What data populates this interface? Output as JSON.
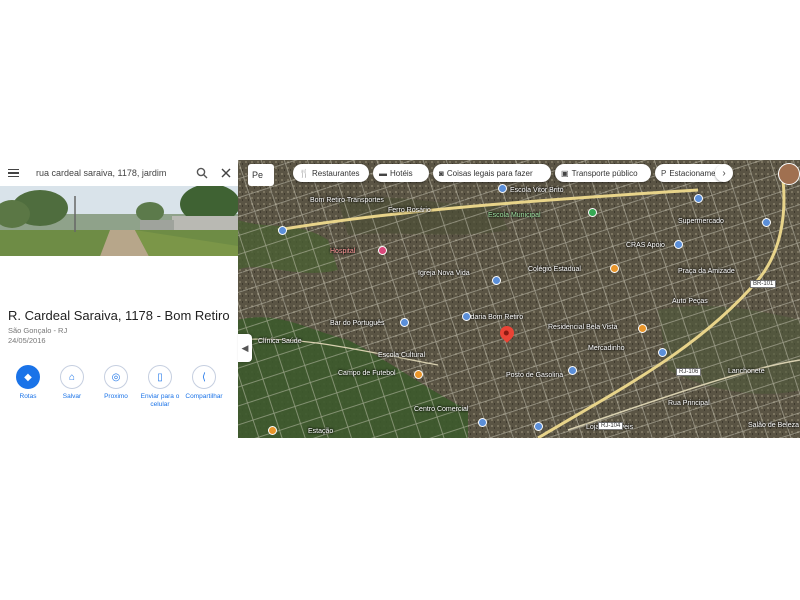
{
  "search": {
    "query": "rua cardeal saraiva, 1178, jardim"
  },
  "place": {
    "title": "R. Cardeal Saraiva, 1178 - Bom Retiro",
    "city": "São Gonçalo - RJ",
    "date": "24/05/2016"
  },
  "actions": [
    {
      "label": "Rotas",
      "icon": "◆"
    },
    {
      "label": "Salvar",
      "icon": "⌂"
    },
    {
      "label": "Proximo",
      "icon": "◎"
    },
    {
      "label": "Enviar para o\ncelular",
      "icon": "▯"
    },
    {
      "label": "Compartilhar",
      "icon": "⟨"
    }
  ],
  "panel_footer": "",
  "map": {
    "layer_label": "Pe",
    "chips": [
      {
        "label": "Restaurantes",
        "icon": "🍴"
      },
      {
        "label": "Hotéis",
        "icon": "▬"
      },
      {
        "label": "Coisas legais para fazer",
        "icon": "◙"
      },
      {
        "label": "Transporte público",
        "icon": "▣"
      },
      {
        "label": "Estacionamento",
        "icon": "P"
      }
    ],
    "labels": [
      {
        "text": "Escola Vitor Brito",
        "tone": "white"
      },
      {
        "text": "Bom Retiro Transportes",
        "tone": "white"
      },
      {
        "text": "Ferro Rosário",
        "tone": "white"
      },
      {
        "text": "Escola Municipal",
        "tone": "green"
      },
      {
        "text": "Hospital",
        "tone": "red"
      },
      {
        "text": "Igreja Nova Vida",
        "tone": "white"
      },
      {
        "text": "Colégio Estadual",
        "tone": "white"
      },
      {
        "text": "CRAS Apoio",
        "tone": "white"
      },
      {
        "text": "Supermercado",
        "tone": "white"
      },
      {
        "text": "Praça da Amizade",
        "tone": "white"
      },
      {
        "text": "Bar do Português",
        "tone": "white"
      },
      {
        "text": "Residencial Bela Vista",
        "tone": "white"
      },
      {
        "text": "Padaria Bom Retiro",
        "tone": "white"
      },
      {
        "text": "Clínica Saúde",
        "tone": "white"
      },
      {
        "text": "Escola Cultural",
        "tone": "white"
      },
      {
        "text": "Mercadinho",
        "tone": "white"
      },
      {
        "text": "Campo de Futebol",
        "tone": "white"
      },
      {
        "text": "Posto de Gasolina",
        "tone": "white"
      },
      {
        "text": "Auto Peças",
        "tone": "white"
      },
      {
        "text": "Lanchonete",
        "tone": "white"
      },
      {
        "text": "Centro Comercial",
        "tone": "white"
      },
      {
        "text": "Estação",
        "tone": "white"
      },
      {
        "text": "Loja de Móveis",
        "tone": "white"
      },
      {
        "text": "Rua Principal",
        "tone": "white"
      },
      {
        "text": "Salão de Beleza",
        "tone": "white"
      }
    ],
    "shields": [
      "RJ-104",
      "RJ-106",
      "BR-101"
    ]
  }
}
